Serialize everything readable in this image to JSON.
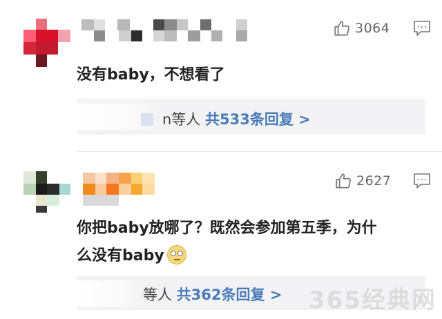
{
  "comments": [
    {
      "likes": "3064",
      "text_lines": [
        "没有baby，不想看了"
      ],
      "reply_prefix": "n等人",
      "reply_link": "共533条回复 >"
    },
    {
      "likes": "2627",
      "text_lines": [
        "你把baby放哪了？既然会参加第五季，为什",
        "么没有baby"
      ],
      "reply_prefix": "等人",
      "reply_link": "共362条回复 >"
    }
  ],
  "icons": {
    "like": "thumbs-up-icon",
    "reply": "reply-comment-icon",
    "emoji": "rolling-eyes-emoji"
  },
  "colors": {
    "link": "#4a7bb8",
    "text": "#222222",
    "meta": "#666666",
    "reply_bg": "#f3f3f5"
  },
  "watermark": "365经典网"
}
